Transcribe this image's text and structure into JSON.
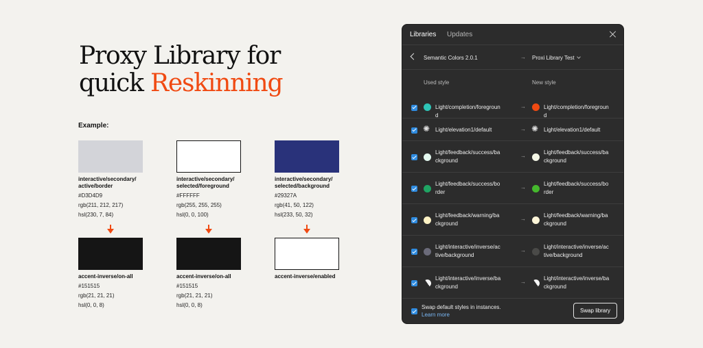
{
  "hero": {
    "line1": "Proxy Library for",
    "line2_plain": "quick ",
    "line2_accent": "Reskinning"
  },
  "example_label": "Example:",
  "colors": {
    "accent": "#f04a12",
    "checkbox": "#2f8bdf",
    "panel_bg": "#2c2c2c"
  },
  "source_cards": [
    {
      "name": "interactive/secondary/ active/border",
      "hex": "#D3D4D9",
      "rgb": "rgb(211, 212, 217)",
      "hsl": "hsl(230, 7, 84)",
      "swatch": "#D3D4D9",
      "bordered": false
    },
    {
      "name": "interactive/secondary/ selected/foreground",
      "hex": "#FFFFFF",
      "rgb": "rgb(255, 255, 255)",
      "hsl": "hsl(0, 0, 100)",
      "swatch": "#FFFFFF",
      "bordered": true
    },
    {
      "name": "interactive/secondary/ selected/background",
      "hex": "#29327A",
      "rgb": "rgb(41, 50, 122)",
      "hsl": "hsl(233, 50, 32)",
      "swatch": "#29327A",
      "bordered": false
    }
  ],
  "target_cards": [
    {
      "name": "accent-inverse/on-all",
      "hex": "#151515",
      "rgb": "rgb(21, 21, 21)",
      "hsl": "hsl(0, 0, 8)",
      "swatch": "#151515",
      "bordered": false
    },
    {
      "name": "accent-inverse/on-all",
      "hex": "#151515",
      "rgb": "rgb(21, 21, 21)",
      "hsl": "hsl(0, 0, 8)",
      "swatch": "#151515",
      "bordered": false
    },
    {
      "name": "accent-inverse/enabled",
      "hex": "",
      "rgb": "",
      "hsl": "",
      "swatch": "#FFFFFF",
      "bordered": true
    }
  ],
  "panel": {
    "tabs": [
      "Libraries",
      "Updates"
    ],
    "from_library": "Semantic Colors 2.0.1",
    "arrow": "→",
    "to_library": "Proxi Library Test",
    "used_style_header": "Used style",
    "new_style_header": "New style",
    "rows": [
      {
        "used": "Light/completion/foreground",
        "used_icon": "dot",
        "used_color": "#2ec4b6",
        "new": "Light/completion/foreground",
        "new_icon": "dot",
        "new_color": "#f04a12"
      },
      {
        "used": "Light/elevation1/default",
        "used_icon": "sun",
        "used_color": "",
        "new": "Light/elevation1/default",
        "new_icon": "sun",
        "new_color": ""
      },
      {
        "used": "Light/feedback/success/background",
        "used_icon": "dot",
        "used_color": "#e3f7ee",
        "new": "Light/feedback/success/background",
        "new_icon": "dot",
        "new_color": "#f4f6e6"
      },
      {
        "used": "Light/feedback/success/border",
        "used_icon": "dot",
        "used_color": "#1fa463",
        "new": "Light/feedback/success/border",
        "new_icon": "dot",
        "new_color": "#45b82d"
      },
      {
        "used": "Light/feedback/warning/background",
        "used_icon": "dot",
        "used_color": "#fdf2c4",
        "new": "Light/feedback/warning/background",
        "new_icon": "dot",
        "new_color": "#fdf5d8"
      },
      {
        "used": "Light/interactive/inverse/active/background",
        "used_icon": "dot",
        "used_color": "#6b6b7a",
        "new": "Light/interactive/inverse/active/background",
        "new_icon": "dot",
        "new_color": "#4a4a48"
      },
      {
        "used": "Light/interactive/inverse/background",
        "used_icon": "half",
        "used_color": "",
        "new": "Light/interactive/inverse/background",
        "new_icon": "half",
        "new_color": ""
      }
    ],
    "swap_default_text": "Swap default styles in instances.",
    "learn_more": "Learn more",
    "swap_button": "Swap library"
  }
}
